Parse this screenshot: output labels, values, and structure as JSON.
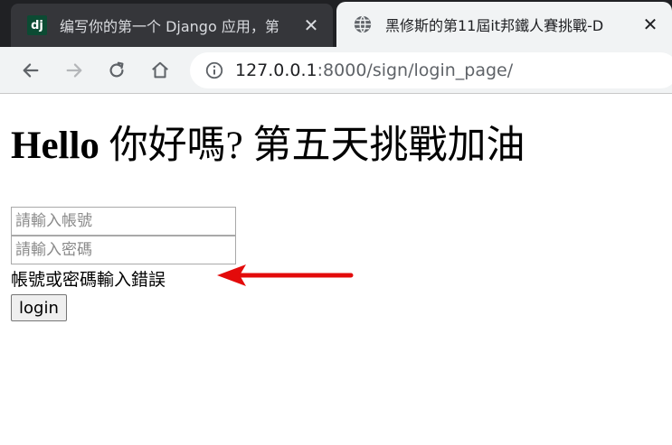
{
  "browser": {
    "tabs": [
      {
        "title": "编写你的第一个 Django 应用，第",
        "favicon": "django-icon",
        "favicon_text": "dj",
        "active": false
      },
      {
        "title": "黑修斯的第11屆it邦鐵人賽挑戰-D",
        "favicon": "globe-icon",
        "active": true
      }
    ],
    "close_glyph": "✕",
    "address": {
      "host": "127.0.0.1",
      "rest": ":8000/sign/login_page/"
    }
  },
  "page": {
    "title_latin": "Hello ",
    "title_cjk": "你好嗎? 第五天挑戰加油",
    "username_placeholder": "請輸入帳號",
    "password_placeholder": "請輸入密碼",
    "error_message": "帳號或密碼輸入錯誤",
    "login_label": "login"
  },
  "colors": {
    "annotation_arrow": "#e30b0b",
    "tabstrip": "#202124",
    "toolbar": "#f1f3f4"
  }
}
